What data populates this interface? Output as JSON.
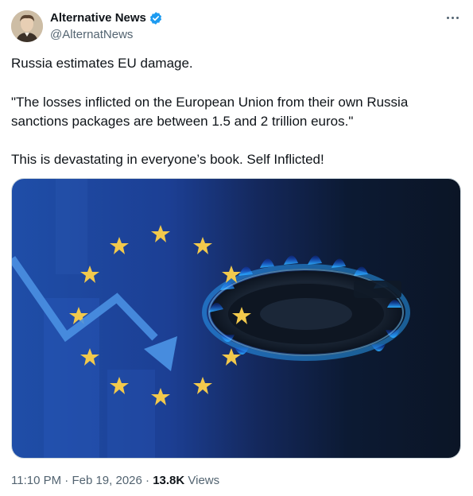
{
  "author": {
    "display_name": "Alternative News",
    "handle": "@AlternatNews",
    "verified": true,
    "avatar_icon": "portrait-photo"
  },
  "tweet": {
    "lines": [
      "Russia estimates EU damage.",
      "\"The losses inflicted on the European Union from their own Russia",
      "sanctions packages are between 1.5 and 2 trillion euros.\"",
      "This is devastating in everyone’s book. Self Inflicted!"
    ]
  },
  "meta": {
    "time": "11:10 PM",
    "sep1": "·",
    "date": "Feb 19, 2026",
    "sep2": "·",
    "views_count": "13.8K",
    "views_label": "Views"
  },
  "icons": {
    "more": "more-horizontal-icon",
    "verified": "verified-badge-icon"
  },
  "colors": {
    "verified_blue": "#1d9bf0",
    "text": "#0f1419",
    "secondary": "#536471"
  }
}
